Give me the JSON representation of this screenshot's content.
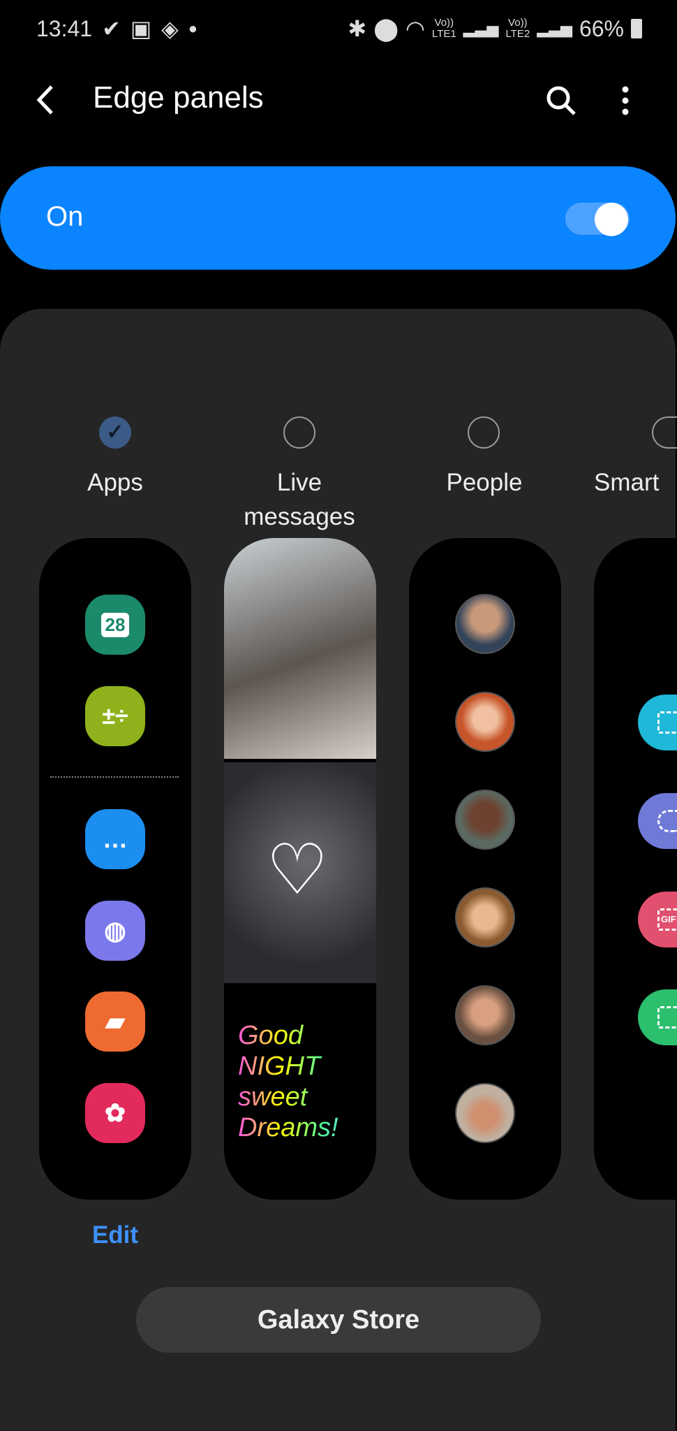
{
  "status_bar": {
    "time": "13:41",
    "battery": "66%",
    "sim1": "LTE1",
    "sim2": "LTE2",
    "volte": "Vo))"
  },
  "header": {
    "title": "Edge panels"
  },
  "master_toggle": {
    "label": "On",
    "state": true
  },
  "panels": [
    {
      "label": "Apps",
      "selected": true
    },
    {
      "label": "Live",
      "label2": "messages",
      "selected": false
    },
    {
      "label": "People",
      "selected": false
    },
    {
      "label": "Smart",
      "selected": false
    }
  ],
  "apps_panel": {
    "calendar_day": "28"
  },
  "live_messages": {
    "text": "Good NIGHT sweet Dreams!"
  },
  "smart_panel": {
    "gif_label": "GIF"
  },
  "edit_label": "Edit",
  "store_label": "Galaxy Store",
  "colors": {
    "accent": "#0a84ff",
    "edit": "#3e91ff",
    "card": "#252525"
  }
}
